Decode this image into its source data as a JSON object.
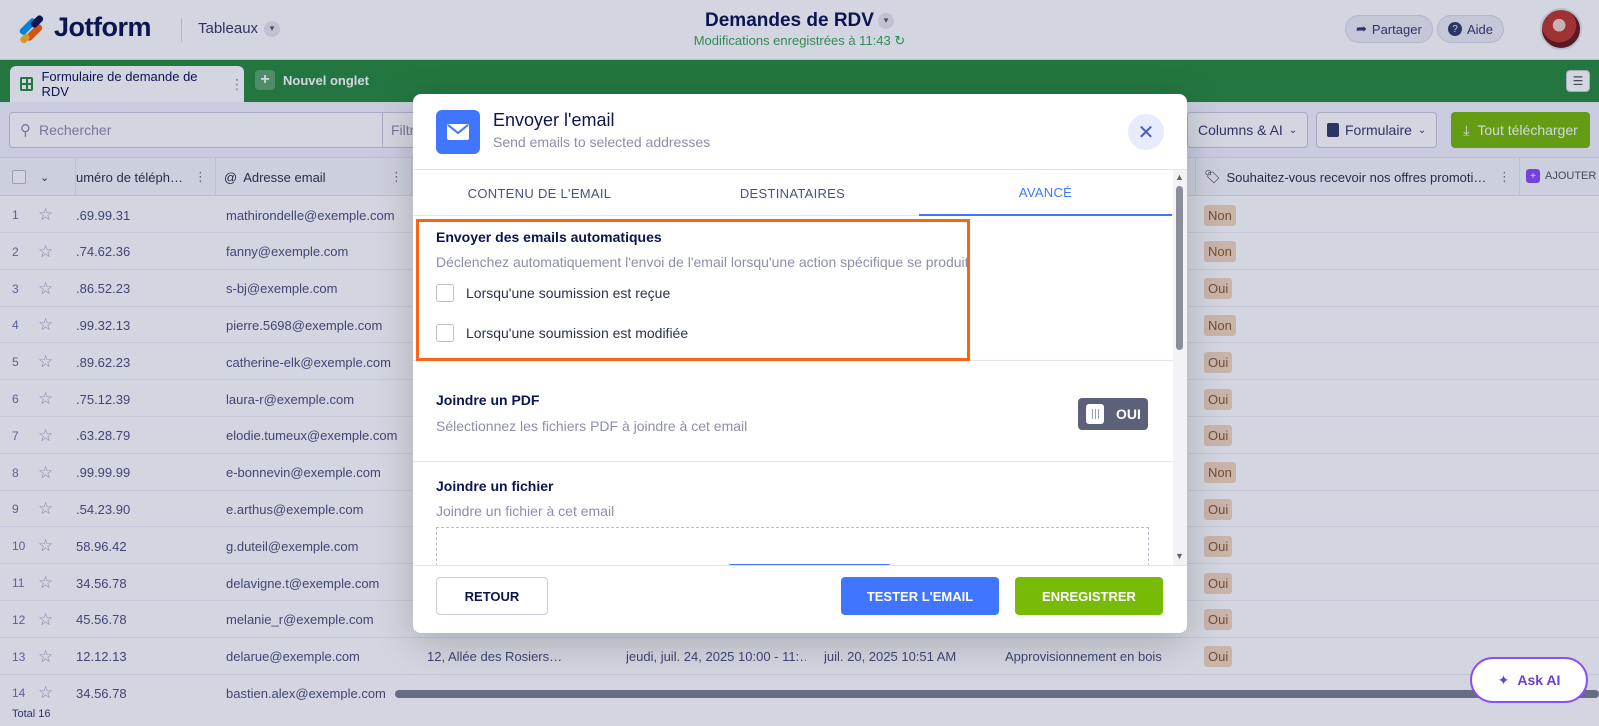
{
  "header": {
    "brand": "Jotform",
    "tables_menu": "Tableaux",
    "title": "Demandes de RDV",
    "saved_status": "Modifications enregistrées à 11:43",
    "share_label": "Partager",
    "help_label": "Aide"
  },
  "tabs": {
    "active_label": "Formulaire de demande de RDV",
    "new_tab_label": "Nouvel onglet"
  },
  "toolbar": {
    "search_placeholder": "Rechercher",
    "filter_label": "Filtre",
    "columns_label": "Columns & AI",
    "form_label": "Formulaire",
    "download_label": "Tout télécharger"
  },
  "table": {
    "col_phone": "uméro de téléph…",
    "col_email": "Adresse email",
    "col_promo": "Souhaitez-vous recevoir nos offres promoti…",
    "add_column": "AJOUTER",
    "rows": [
      {
        "n": "1",
        "phone": ".69.99.31",
        "email": "mathirondelle@exemple.com",
        "promo": "Non"
      },
      {
        "n": "2",
        "phone": ".74.62.36",
        "email": "fanny@exemple.com",
        "promo": "Non"
      },
      {
        "n": "3",
        "phone": ".86.52.23",
        "email": "s-bj@exemple.com",
        "promo": "Oui"
      },
      {
        "n": "4",
        "phone": ".99.32.13",
        "email": "pierre.5698@exemple.com",
        "promo": "Non"
      },
      {
        "n": "5",
        "phone": ".89.62.23",
        "email": "catherine-elk@exemple.com",
        "promo": "Oui"
      },
      {
        "n": "6",
        "phone": ".75.12.39",
        "email": "laura-r@exemple.com",
        "promo": "Oui"
      },
      {
        "n": "7",
        "phone": ".63.28.79",
        "email": "elodie.tumeux@exemple.com",
        "promo": "Oui"
      },
      {
        "n": "8",
        "phone": ".99.99.99",
        "email": "e-bonnevin@exemple.com",
        "promo": "Non"
      },
      {
        "n": "9",
        "phone": ".54.23.90",
        "email": "e.arthus@exemple.com",
        "promo": "Oui"
      },
      {
        "n": "10",
        "phone": "58.96.42",
        "email": "g.duteil@exemple.com",
        "promo": "Oui"
      },
      {
        "n": "11",
        "phone": "34.56.78",
        "email": "delavigne.t@exemple.com",
        "promo": "Oui"
      },
      {
        "n": "12",
        "phone": "45.56.78",
        "email": "melanie_r@exemple.com",
        "promo": "Oui"
      },
      {
        "n": "13",
        "phone": "12.12.13",
        "email": "delarue@exemple.com",
        "promo": "Oui",
        "address": "12, Allée des Rosiers…",
        "rdv": "jeudi, juil. 24, 2025 10:00 - 11:…",
        "submitted": "juil. 20, 2025 10:51 AM",
        "subject": "Approvisionnement en bois"
      },
      {
        "n": "14",
        "phone": "34.56.78",
        "email": "bastien.alex@exemple.com",
        "promo": ""
      }
    ],
    "total_label": "Total 16"
  },
  "ask_ai_label": "Ask AI",
  "modal": {
    "title": "Envoyer l'email",
    "subtitle": "Send emails to selected addresses",
    "tabs": [
      "CONTENU DE L'EMAIL",
      "DESTINATAIRES",
      "AVANCÉ"
    ],
    "auto_title": "Envoyer des emails automatiques",
    "auto_desc": "Déclenchez automatiquement l'envoi de l'email lorsqu'une action spécifique se produit",
    "opt_received": "Lorsqu'une soumission est reçue",
    "opt_modified": "Lorsqu'une soumission est modifiée",
    "pdf_title": "Joindre un PDF",
    "pdf_desc": "Sélectionnez les fichiers PDF à joindre à cet email",
    "pdf_toggle": "OUI",
    "file_title": "Joindre un fichier",
    "file_desc": "Joindre un fichier à cet email",
    "back_label": "RETOUR",
    "test_label": "TESTER L'EMAIL",
    "save_label": "ENREGISTRER"
  },
  "colors": {
    "green_bar": "#2a8b3c",
    "primary_blue": "#3f75ff",
    "save_green": "#78bb07",
    "highlight_orange": "#f96514"
  }
}
